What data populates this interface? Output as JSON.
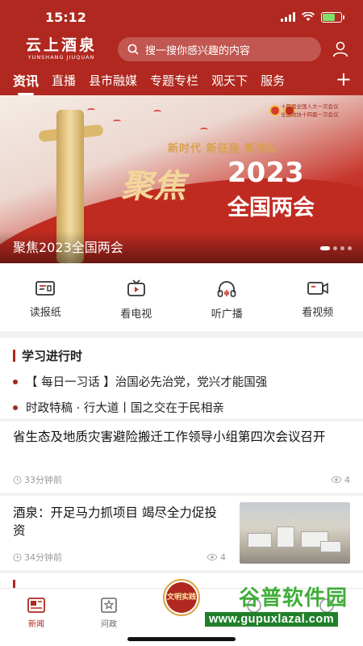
{
  "status": {
    "time": "15:12"
  },
  "header": {
    "logo_cn": "云上酒泉",
    "logo_en": "YUNSHANG JIUQUAN",
    "search_placeholder": "搜一搜你感兴趣的内容",
    "user_icon": "user-icon"
  },
  "tabs": [
    "资讯",
    "直播",
    "县市融媒",
    "专题专栏",
    "观天下",
    "服务"
  ],
  "active_tab": "资讯",
  "banner": {
    "slogan": "新时代 新征程 新伟业",
    "big": "聚焦",
    "year": "2023",
    "sub": "全国两会",
    "badge_line1": "十四届全国人大一次会议",
    "badge_line2": "全国政协十四届一次会议",
    "caption": "聚焦2023全国两会",
    "dots": 4,
    "active_dot": 0
  },
  "tools": [
    {
      "label": "读报纸",
      "icon": "newspaper-icon"
    },
    {
      "label": "看电视",
      "icon": "tv-icon"
    },
    {
      "label": "听广播",
      "icon": "headphones-icon"
    },
    {
      "label": "看视频",
      "icon": "video-camera-icon"
    }
  ],
  "study": {
    "title": "学习进行时",
    "items": [
      "【 每日一习话 】治国必先治党，党兴才能国强",
      "时政特稿 · 行大道丨国之交在于民相亲"
    ]
  },
  "news": [
    {
      "title": "省生态及地质灾害避险搬迁工作领导小组第四次会议召开",
      "time": "33分钟前",
      "views": "4"
    },
    {
      "title": "酒泉：开足马力抓项目 竭尽全力促投资",
      "time": "34分钟前",
      "views": "4"
    }
  ],
  "bottom_nav": [
    {
      "label": "新闻",
      "icon": "news-icon"
    },
    {
      "label": "问政",
      "icon": "inquiry-icon"
    },
    {
      "label": "",
      "icon": "civilization-badge-icon"
    },
    {
      "label": "",
      "icon": "nav-icon-4"
    },
    {
      "label": "",
      "icon": "nav-icon-5"
    }
  ],
  "center_badge_text": "文明实践",
  "watermark": {
    "line1": "谷普软件园",
    "line2": "www.gupuxlazal.com"
  },
  "colors": {
    "brand_red": "#b0281f",
    "watermark_green": "#3fae3a"
  }
}
